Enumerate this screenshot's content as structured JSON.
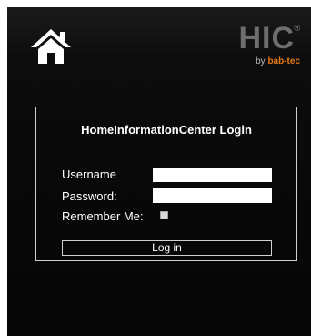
{
  "header": {
    "home_icon": "home-icon",
    "logo": {
      "main": "HIC",
      "registered": "®",
      "by": "by",
      "brand": "bab-tec",
      "brand_color": "#e67a18"
    }
  },
  "login": {
    "title": "HomeInformationCenter Login",
    "username_label": "Username",
    "username_value": "",
    "password_label": "Password:",
    "password_value": "",
    "remember_label": "Remember Me:",
    "remember_checked": false,
    "submit_label": "Log in"
  },
  "colors": {
    "background": "#0a0a0a",
    "text": "#ffffff",
    "border": "#cfcfcf",
    "logo_gray": "#6e6e6e"
  }
}
